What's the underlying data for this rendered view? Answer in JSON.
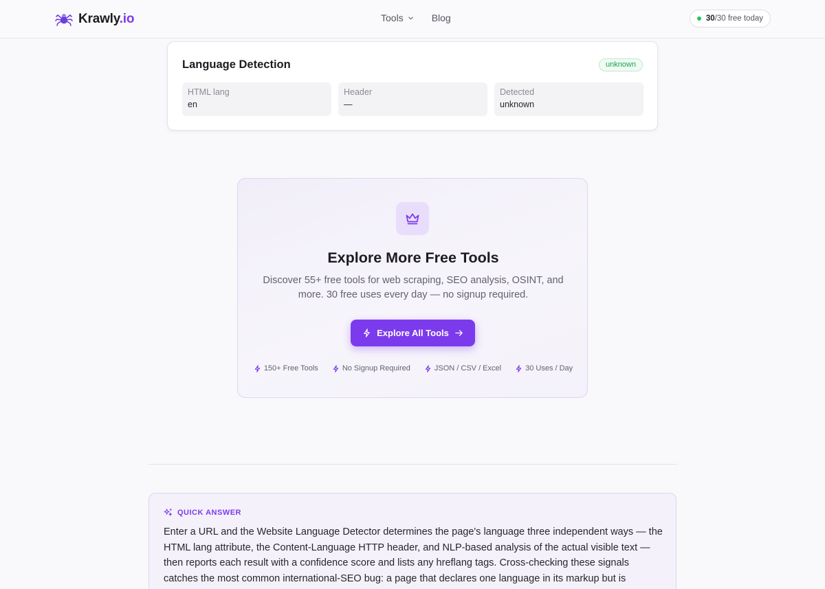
{
  "header": {
    "brand": "Krawly",
    "brand_tld": ".io",
    "nav": [
      {
        "label": "Tools",
        "has_dropdown": true
      },
      {
        "label": "Blog",
        "has_dropdown": false
      }
    ],
    "quota": {
      "used": "30",
      "rest": "/30 free today",
      "status_color": "#22c55e"
    }
  },
  "language_detection": {
    "title": "Language Detection",
    "status_badge": "unknown",
    "fields": [
      {
        "label": "HTML lang",
        "value": "en"
      },
      {
        "label": "Header",
        "value": "—"
      },
      {
        "label": "Detected",
        "value": "unknown"
      }
    ]
  },
  "promo": {
    "icon": "crown-icon",
    "title": "Explore More Free Tools",
    "description": "Discover 55+ free tools for web scraping, SEO analysis, OSINT, and more. 30 free uses every day — no signup required.",
    "button_label": "Explore All Tools",
    "features": [
      "150+ Free Tools",
      "No Signup Required",
      "JSON / CSV / Excel",
      "30 Uses / Day"
    ]
  },
  "quick_answer": {
    "heading": "QUICK ANSWER",
    "body": "Enter a URL and the Website Language Detector determines the page's language three independent ways — the HTML lang attribute, the Content-Language HTTP header, and NLP-based analysis of the actual visible text — then reports each result with a confidence score and lists any hreflang tags. Cross-checking these signals catches the most common international-SEO bug: a page that declares one language in its markup but is"
  },
  "colors": {
    "accent": "#7c3aed",
    "success": "#16a34a",
    "background": "#f9f9fb"
  }
}
